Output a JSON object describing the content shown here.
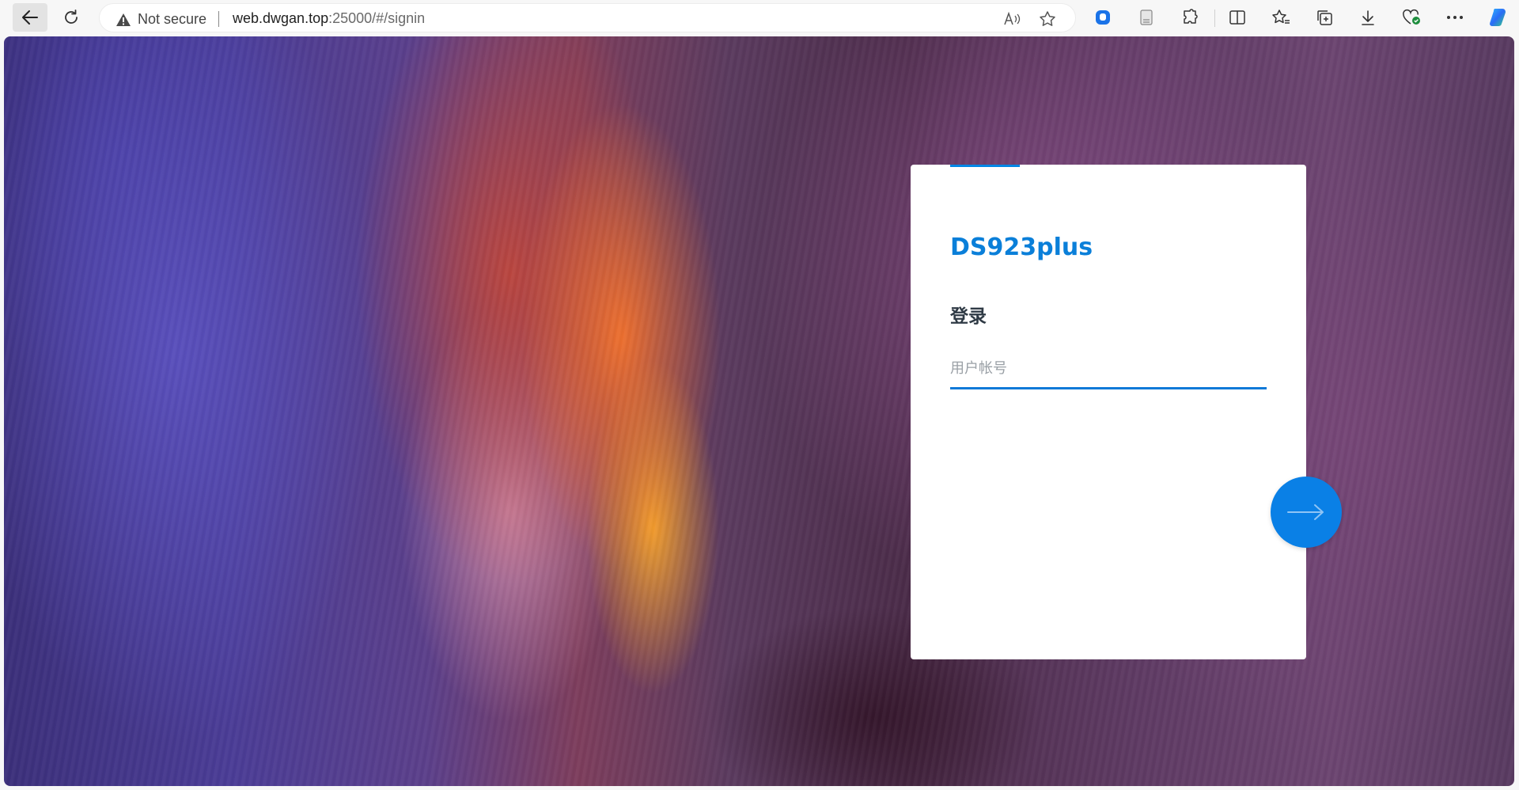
{
  "browser": {
    "security_label": "Not secure",
    "url_host": "web.dwgan.top",
    "url_rest": ":25000/#/signin"
  },
  "login": {
    "title": "DS923plus",
    "subtitle": "登录",
    "username_placeholder": "用户帐号",
    "username_value": ""
  },
  "colors": {
    "accent": "#0a80e6",
    "title": "#0a7fd9",
    "subtitle": "#2f3a45"
  },
  "icons": {
    "toolbar": [
      "back-arrow-icon",
      "reload-icon",
      "warning-icon",
      "read-aloud-icon",
      "favorite-star-icon",
      "extension-shield-icon",
      "page-icon",
      "extensions-puzzle-icon",
      "split-screen-icon",
      "favorites-icon",
      "collections-icon",
      "download-icon",
      "browser-essentials-icon",
      "more-icon",
      "copilot-icon"
    ],
    "next": "arrow-right-icon"
  }
}
